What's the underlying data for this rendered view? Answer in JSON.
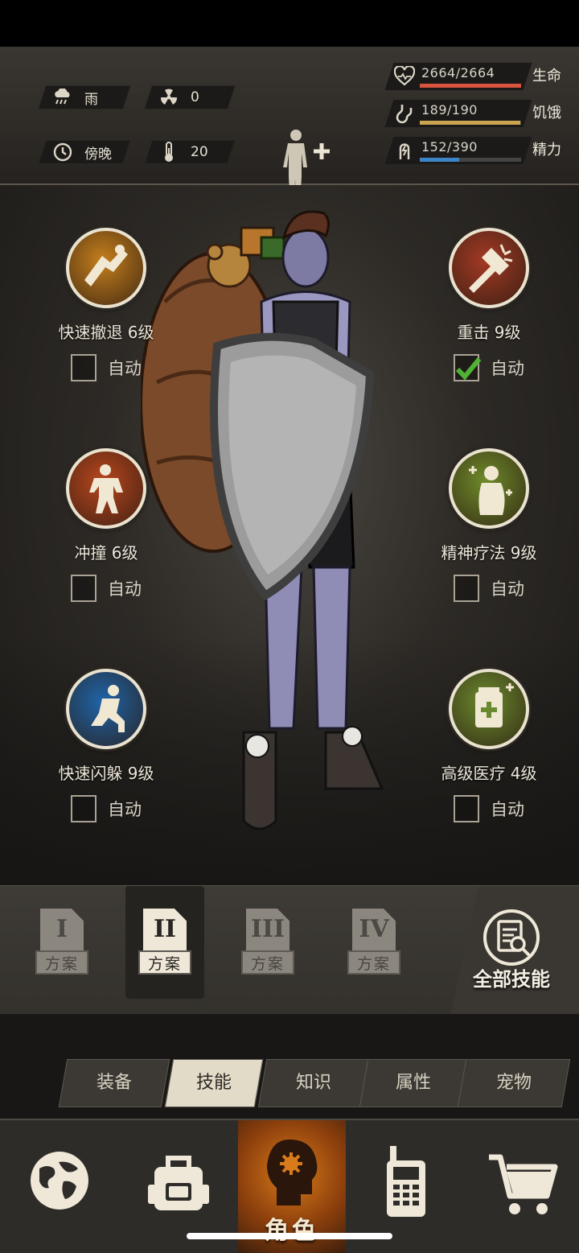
{
  "hud": {
    "weather": {
      "icon": "rain-cloud-icon",
      "label": "雨"
    },
    "radiation": {
      "icon": "radiation-icon",
      "value": "0"
    },
    "time": {
      "icon": "clock-icon",
      "label": "傍晚"
    },
    "temperature": {
      "icon": "thermometer-icon",
      "value": "20"
    },
    "stats": [
      {
        "icon": "heart-icon",
        "value": "2664/2664",
        "label": "生命",
        "fill": 1.0,
        "color": "#d8543f"
      },
      {
        "icon": "stomach-icon",
        "value": "189/190",
        "label": "饥饿",
        "fill": 0.995,
        "color": "#c9a451"
      },
      {
        "icon": "energy-icon",
        "value": "152/390",
        "label": "精力",
        "fill": 0.39,
        "color": "#3d86c6"
      }
    ]
  },
  "skills": [
    {
      "name": "快速撤退 6级",
      "icon": "retreat-icon",
      "auto_label": "自动",
      "auto": false,
      "color": "#c57f1d"
    },
    {
      "name": "重击 9级",
      "icon": "heavy-strike-icon",
      "auto_label": "自动",
      "auto": true,
      "color": "#a33a24"
    },
    {
      "name": "冲撞 6级",
      "icon": "charge-icon",
      "auto_label": "自动",
      "auto": false,
      "color": "#b8461e"
    },
    {
      "name": "精神疗法 9级",
      "icon": "mental-therapy-icon",
      "auto_label": "自动",
      "auto": false,
      "color": "#6e8a2a"
    },
    {
      "name": "快速闪躲 9级",
      "icon": "dodge-icon",
      "auto_label": "自动",
      "auto": false,
      "color": "#1f64a8"
    },
    {
      "name": "高级医疗 4级",
      "icon": "medical-kit-icon",
      "auto_label": "自动",
      "auto": false,
      "color": "#6b8a2e"
    }
  ],
  "plans": [
    {
      "numeral": "I",
      "label": "方案",
      "active": false
    },
    {
      "numeral": "II",
      "label": "方案",
      "active": true
    },
    {
      "numeral": "III",
      "label": "方案",
      "active": false
    },
    {
      "numeral": "IV",
      "label": "方案",
      "active": false
    }
  ],
  "all_skills_label": "全部技能",
  "tabs": [
    {
      "label": "装备",
      "active": false
    },
    {
      "label": "技能",
      "active": true
    },
    {
      "label": "知识",
      "active": false
    },
    {
      "label": "属性",
      "active": false
    },
    {
      "label": "宠物",
      "active": false
    }
  ],
  "nav": {
    "map_icon": "globe-icon",
    "backpack_icon": "backpack-icon",
    "role_label": "角色",
    "radio_icon": "radio-icon",
    "shop_icon": "cart-icon"
  }
}
